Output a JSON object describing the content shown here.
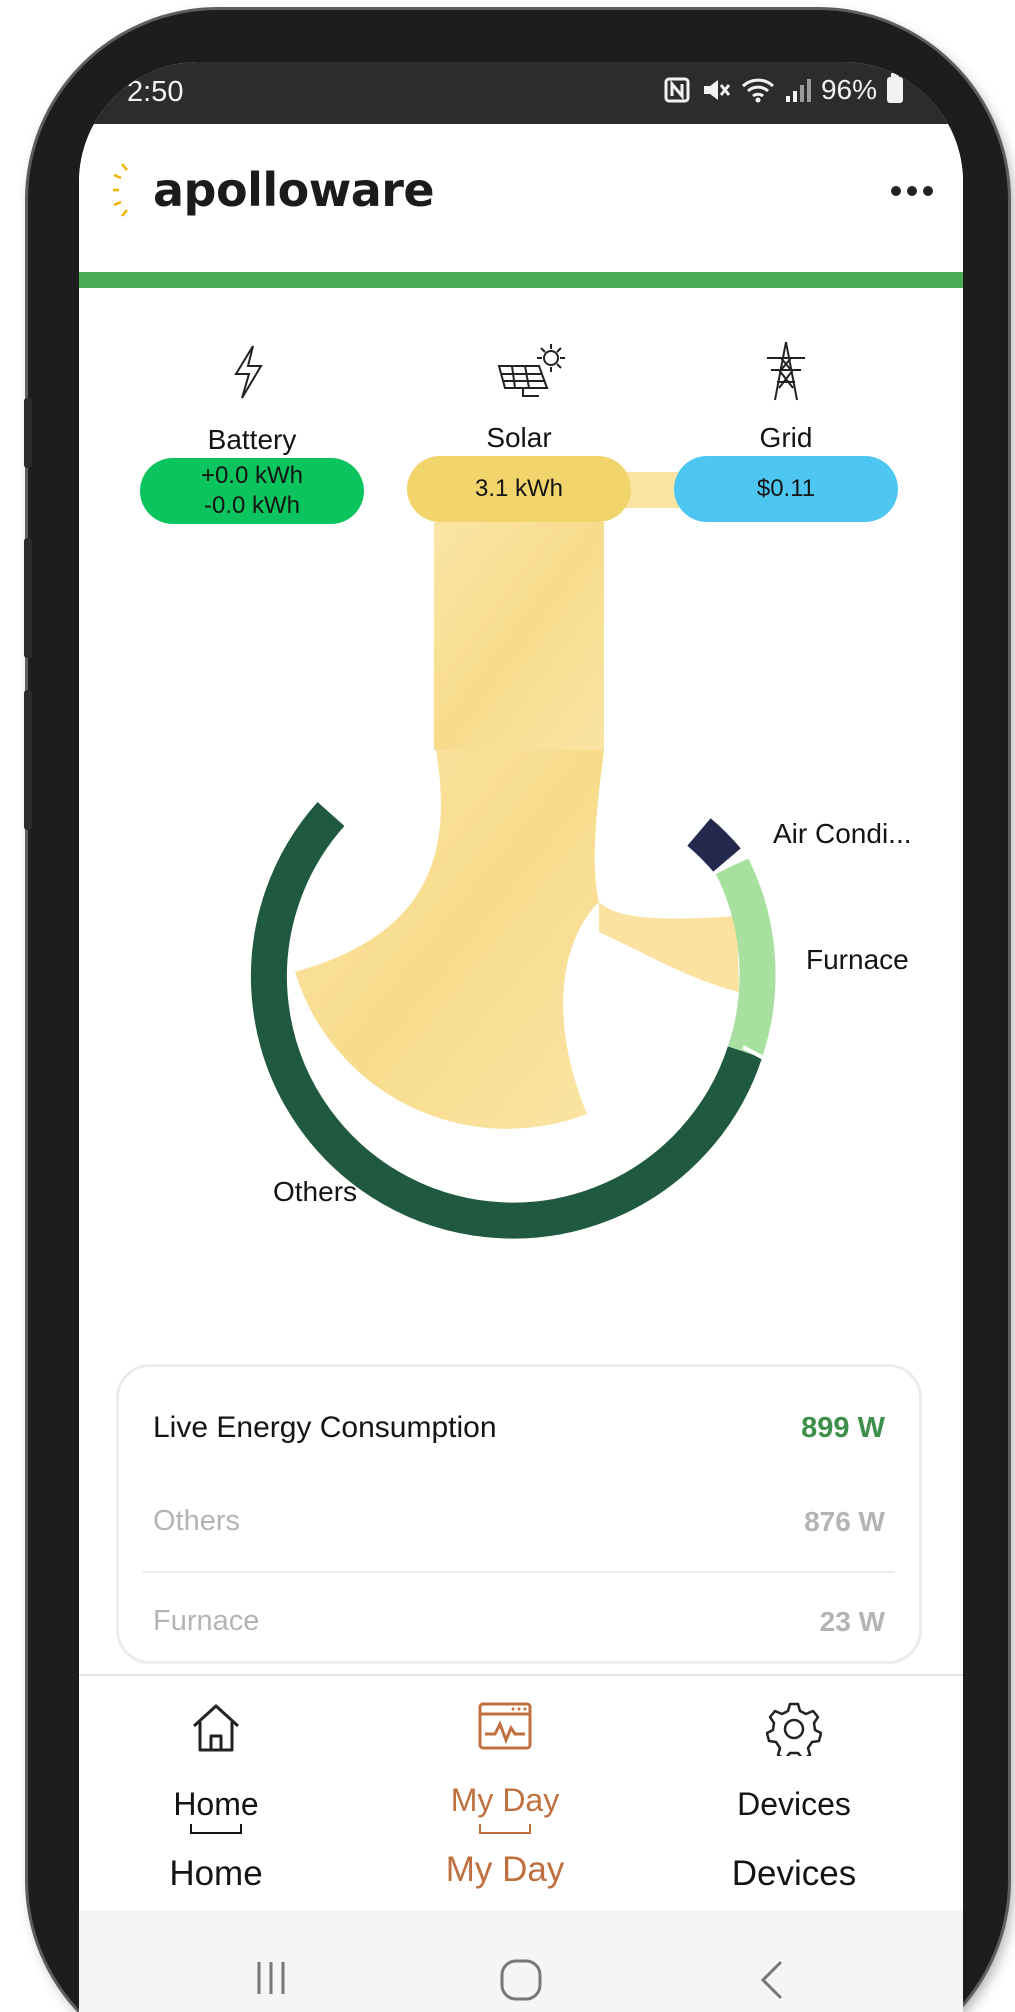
{
  "status_bar": {
    "time": "2:50",
    "battery_percent": "96%",
    "icons": [
      "nfc-icon",
      "mute-icon",
      "wifi-icon",
      "signal-icon",
      "battery-icon"
    ]
  },
  "app": {
    "brand": "apolloware",
    "menu_icon": "more-horizontal-icon",
    "accent_color": "#4aac55"
  },
  "sources": {
    "battery": {
      "label": "Battery",
      "line1": "+0.0 kWh",
      "line2": "-0.0 kWh",
      "icon": "lightning-icon",
      "color": "#0cc45d"
    },
    "solar": {
      "label": "Solar",
      "value": "3.1 kWh",
      "icon": "solar-panel-icon",
      "color": "#f2d46c"
    },
    "grid": {
      "label": "Grid",
      "value": "$0.11",
      "icon": "power-tower-icon",
      "color": "#4dc7f2"
    }
  },
  "consumers": [
    {
      "label": "Air Condi...",
      "color": "#23294d"
    },
    {
      "label": "Furnace",
      "color": "#a8e09f"
    },
    {
      "label": "Others",
      "color": "#1f5a40"
    }
  ],
  "live_energy": {
    "title": "Live Energy Consumption",
    "total": "899 W",
    "rows": [
      {
        "label": "Others",
        "value": "876 W"
      },
      {
        "label": "Furnace",
        "value": "23 W"
      }
    ]
  },
  "bottom_nav": [
    {
      "label": "Home",
      "icon": "home-icon",
      "active": false
    },
    {
      "label": "My Day",
      "icon": "activity-chart-icon",
      "active": true
    },
    {
      "label": "Devices",
      "icon": "gear-icon",
      "active": false
    }
  ],
  "android_nav": [
    "recents-icon",
    "home-circle-icon",
    "back-icon"
  ]
}
